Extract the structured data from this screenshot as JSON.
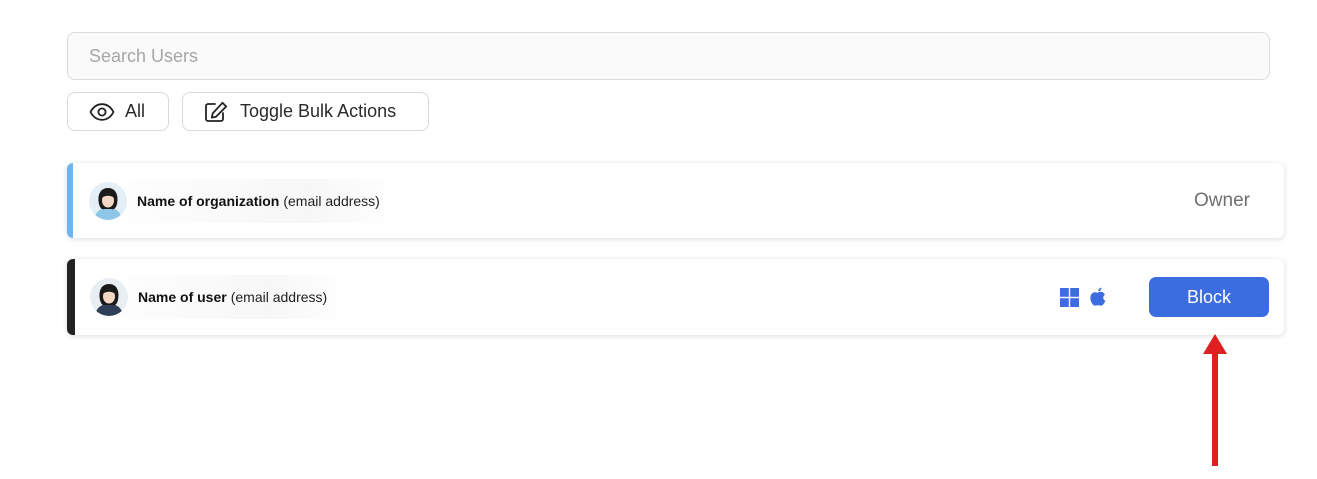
{
  "search": {
    "placeholder": "Search Users"
  },
  "filters": {
    "all_label": "All",
    "bulk_label": "Toggle Bulk Actions"
  },
  "users": [
    {
      "name": "Name of organization",
      "email": "(email address)",
      "role": "Owner",
      "accent_color": "#6cb5f3",
      "avatar_icon": "avatar-woman-icon"
    },
    {
      "name": "Name of user",
      "email": "(email address)",
      "platform_icons": [
        "windows-icon",
        "apple-icon"
      ],
      "action_label": "Block",
      "accent_color": "#222222",
      "avatar_icon": "avatar-woman-icon"
    }
  ],
  "colors": {
    "primary": "#3b6de0",
    "annotation_arrow": "#e02020"
  }
}
